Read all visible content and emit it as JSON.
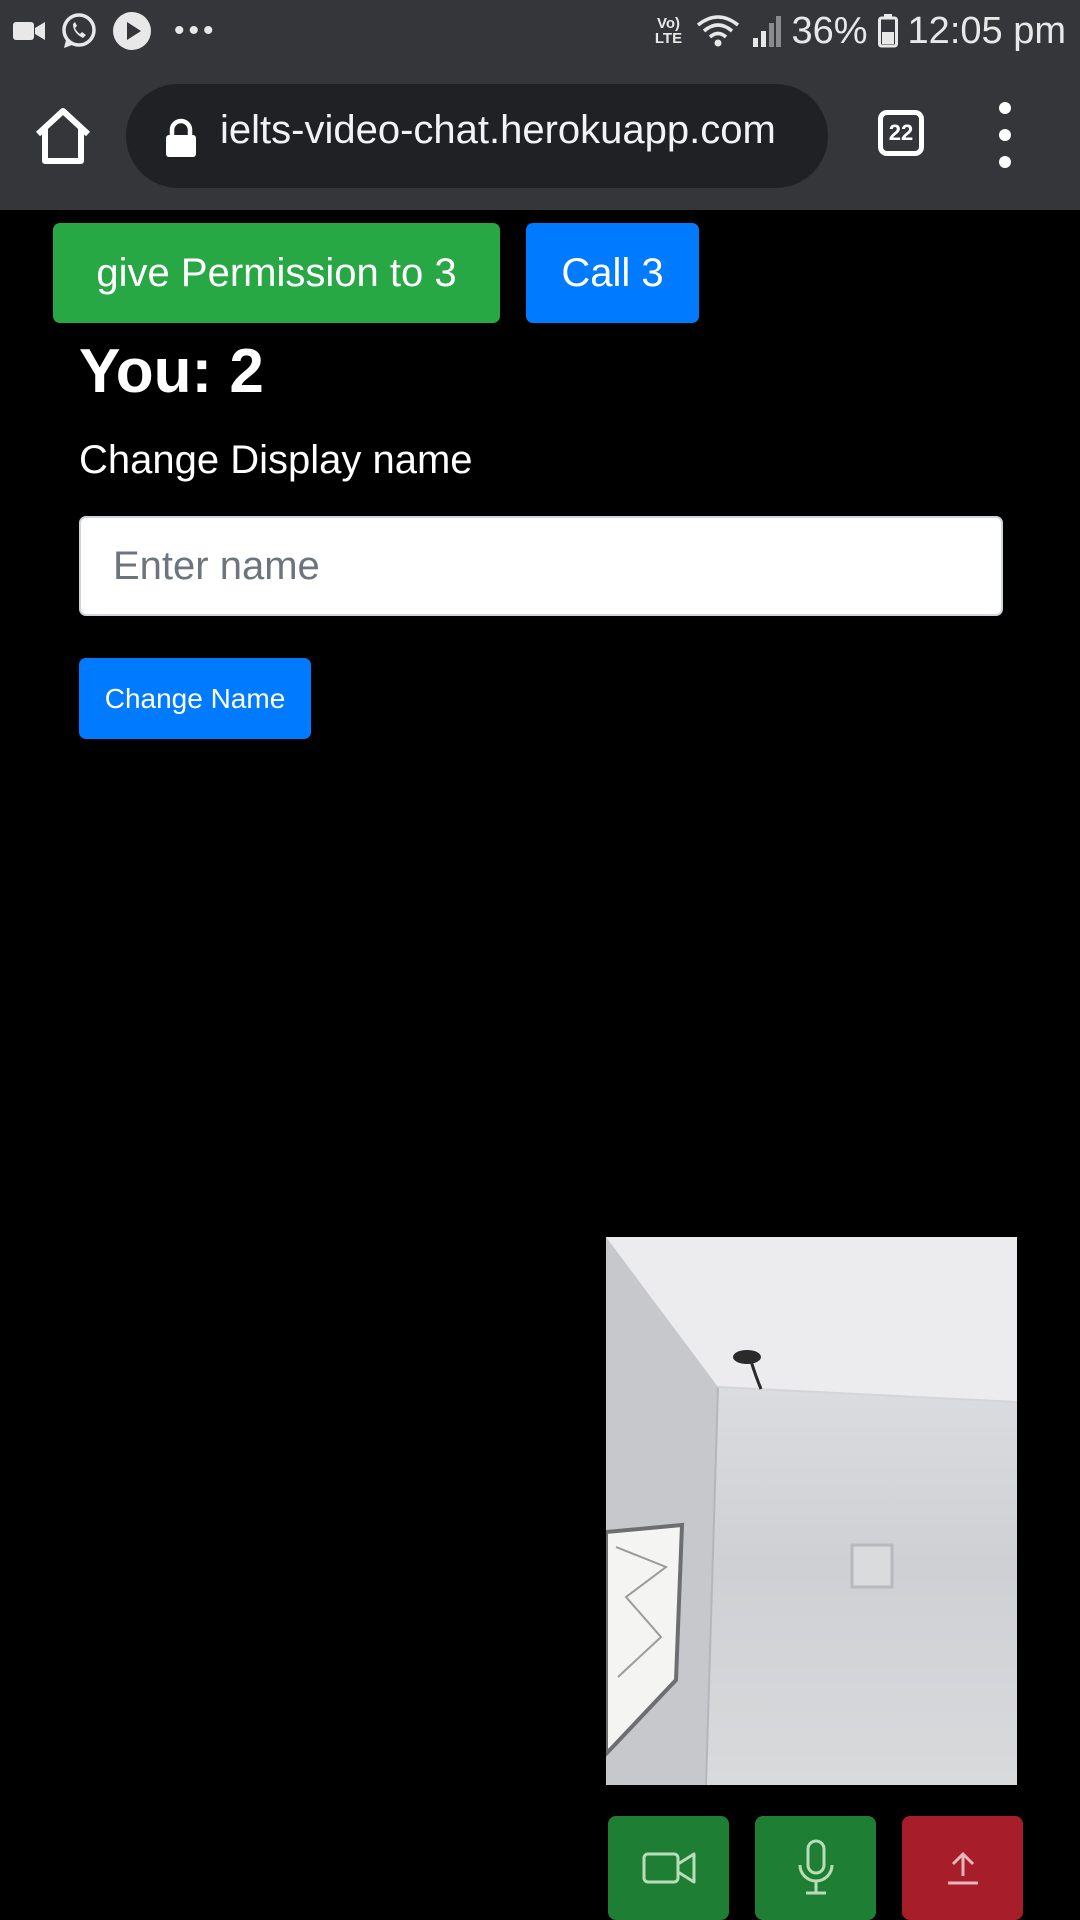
{
  "status_bar": {
    "battery": "36%",
    "time": "12:05 pm",
    "network_label": "Vo) LTE"
  },
  "browser": {
    "url": "ielts-video-chat.herokuapp.com",
    "tab_count": "22"
  },
  "page": {
    "give_permission_label": "give Permission to 3",
    "call_label": "Call 3",
    "you_label": "You: 2",
    "change_display_name_label": "Change Display name",
    "name_input": {
      "placeholder": "Enter name",
      "value": ""
    },
    "change_name_label": "Change Name"
  },
  "controls": {
    "video_icon": "video-camera-icon",
    "mic_icon": "microphone-icon",
    "leave_icon": "upload-arrow-icon"
  },
  "colors": {
    "success": "#28a745",
    "primary": "#007bff",
    "control_green": "#1e7e34",
    "control_red": "#a71d2a",
    "chrome_bar": "#35363a"
  }
}
